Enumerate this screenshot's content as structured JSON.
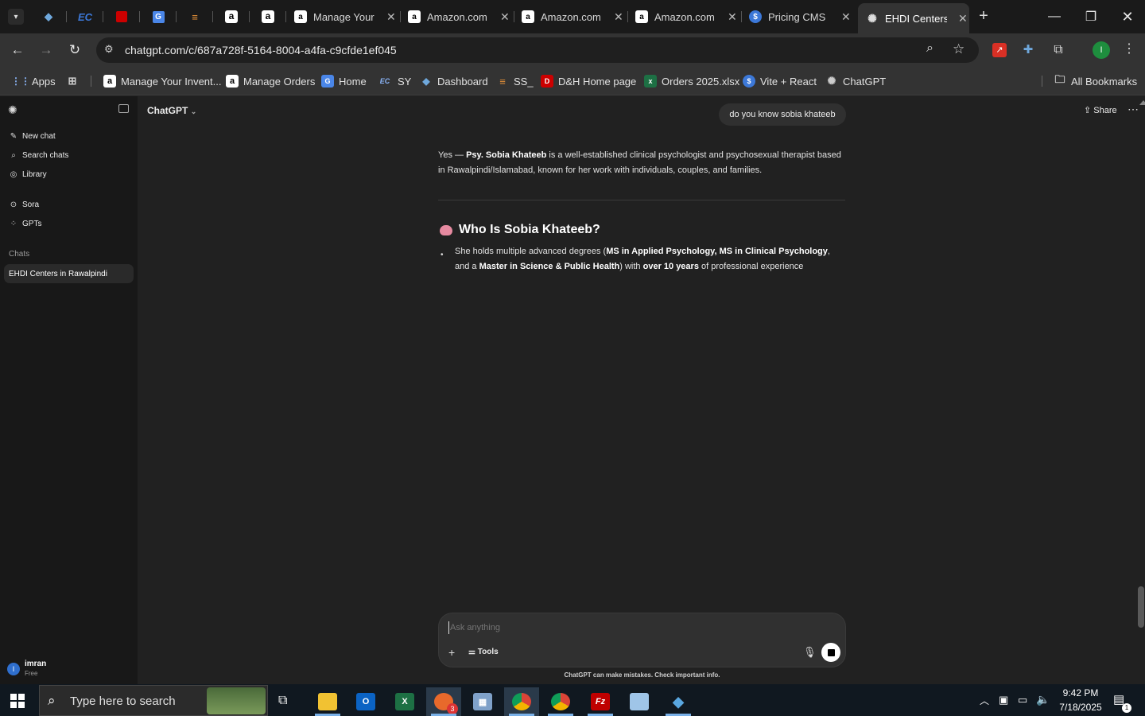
{
  "browser": {
    "pinned_tabs": [
      {
        "icon": "blue-diamond-icon",
        "color": "#6fa8dc",
        "glyph": "◆"
      },
      {
        "icon": "ec-logo-icon",
        "color": "#3c78d8",
        "glyph": "EC"
      },
      {
        "icon": "dh-logo-icon",
        "color": "#cc0000",
        "glyph": "D"
      },
      {
        "icon": "g-page-icon",
        "color": "#4a86e8",
        "glyph": "G"
      },
      {
        "icon": "stack-icon",
        "color": "#e69138",
        "glyph": "≡"
      },
      {
        "icon": "amazon-icon",
        "color": "#ffffff",
        "glyph": "a"
      },
      {
        "icon": "amazon-icon",
        "color": "#ffffff",
        "glyph": "a"
      }
    ],
    "tabs": [
      {
        "title": "Manage Your",
        "icon": "amazon-icon"
      },
      {
        "title": "Amazon.com",
        "icon": "amazon-icon"
      },
      {
        "title": "Amazon.com",
        "icon": "amazon-icon"
      },
      {
        "title": "Amazon.com",
        "icon": "amazon-icon"
      },
      {
        "title": "Pricing CMS",
        "icon": "dollar-icon"
      },
      {
        "title": "EHDI Centers",
        "icon": "chatgpt-icon",
        "active": true
      }
    ],
    "new_tab": "+",
    "url": "chatgpt.com/c/687a728f-5164-8004-a4fa-c9cfde1ef045",
    "bookmarks": [
      {
        "label": "Apps",
        "icon": "apps-grid-icon"
      },
      {
        "label": "",
        "icon": "tab-groups-icon"
      },
      {
        "label": "Manage Your Invent...",
        "icon": "amazon-icon"
      },
      {
        "label": "Manage Orders",
        "icon": "amazon-icon"
      },
      {
        "label": "Home",
        "icon": "g-page-icon"
      },
      {
        "label": "SY",
        "icon": "ec-logo-icon"
      },
      {
        "label": "Dashboard",
        "icon": "blue-diamond-icon"
      },
      {
        "label": "SS_",
        "icon": "stack-icon"
      },
      {
        "label": "D&H Home page",
        "icon": "dh-logo-icon"
      },
      {
        "label": "Orders 2025.xlsx",
        "icon": "excel-icon"
      },
      {
        "label": "Vite + React",
        "icon": "dollar-icon"
      },
      {
        "label": "ChatGPT",
        "icon": "chatgpt-icon"
      }
    ],
    "all_bookmarks": "All Bookmarks",
    "profile_initial": "I"
  },
  "sidebar": {
    "items": [
      {
        "label": "New chat",
        "icon": "pencil-icon"
      },
      {
        "label": "Search chats",
        "icon": "search-icon"
      },
      {
        "label": "Library",
        "icon": "library-icon"
      },
      {
        "label": "Sora",
        "icon": "sora-icon"
      },
      {
        "label": "GPTs",
        "icon": "gpts-icon"
      }
    ],
    "section_label": "Chats",
    "chats": [
      "EHDI Centers in Rawalpindi"
    ],
    "user": {
      "name": "imran",
      "plan": "Free",
      "initial": "I"
    }
  },
  "main": {
    "model": "ChatGPT",
    "share": "Share",
    "user_message": "do you know sobia khateeb",
    "answer": {
      "intro_start": "Yes — ",
      "intro_bold": "Psy. Sobia Khateeb",
      "intro_rest": " is a well-established clinical psychologist and psychosexual therapist based in Rawalpindi/Islamabad, known for her work with individuals, couples, and families.",
      "heading": "Who Is Sobia Khateeb?",
      "bullet": {
        "t1": "She holds multiple advanced degrees (",
        "b1": "MS in Applied Psychology, MS in Clinical Psychology",
        "t2": ", and a ",
        "b2": "Master in Science & Public Health",
        "t3": ") with ",
        "b3": "over 10 years",
        "t4": " of professional experience"
      }
    },
    "composer": {
      "placeholder": "Ask anything",
      "tools": "Tools"
    },
    "disclaimer": "ChatGPT can make mistakes. Check important info."
  },
  "taskbar": {
    "search_placeholder": "Type here to search",
    "apps": [
      {
        "icon": "file-explorer-icon",
        "color": "#f1c232"
      },
      {
        "icon": "outlook-icon",
        "color": "#0b63c4"
      },
      {
        "icon": "excel-icon",
        "color": "#1d7044"
      },
      {
        "icon": "zoom-icon",
        "color": "#e8692b",
        "badge": "3"
      },
      {
        "icon": "calculator-icon",
        "color": "#7fa1c9"
      },
      {
        "icon": "chrome-icon",
        "color": "#4caf50"
      },
      {
        "icon": "chrome-icon",
        "color": "#4caf50"
      },
      {
        "icon": "filezilla-icon",
        "color": "#bf0000"
      },
      {
        "icon": "pen-app-icon",
        "color": "#9fc5e8"
      },
      {
        "icon": "vscode-like-icon",
        "color": "#5aa7e0"
      }
    ],
    "time": "9:42 PM",
    "date": "7/18/2025",
    "notifications": "1"
  }
}
